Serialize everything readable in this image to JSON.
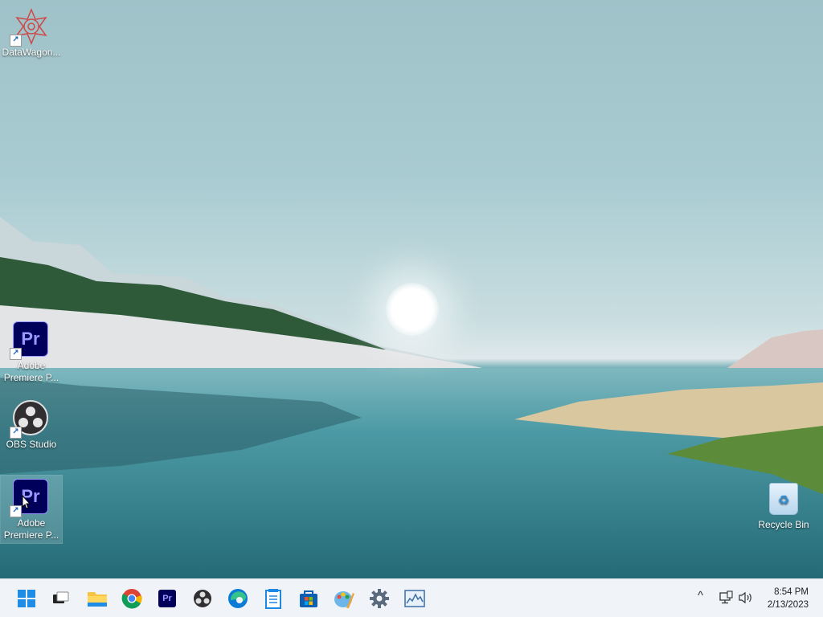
{
  "desktop": {
    "icons": [
      {
        "label": "DataWagon...",
        "icon": "datawagon-icon"
      },
      {
        "label": "Adobe Premiere P...",
        "icon": "premiere-pro-icon"
      },
      {
        "label": "OBS Studio",
        "icon": "obs-studio-icon"
      },
      {
        "label": "Adobe Premiere P...",
        "icon": "premiere-pro-icon"
      },
      {
        "label": "Recycle Bin",
        "icon": "recycle-bin-icon"
      }
    ],
    "premiere_glyph": "Pr"
  },
  "taskbar": {
    "apps": [
      {
        "name": "start",
        "icon": "windows-start-icon"
      },
      {
        "name": "task-view",
        "icon": "task-view-icon"
      },
      {
        "name": "file-explorer",
        "icon": "folder-icon"
      },
      {
        "name": "chrome",
        "icon": "chrome-icon"
      },
      {
        "name": "premiere-pro",
        "icon": "premiere-pro-icon"
      },
      {
        "name": "obs-studio",
        "icon": "obs-icon"
      },
      {
        "name": "edge",
        "icon": "edge-icon"
      },
      {
        "name": "notepad",
        "icon": "notepad-icon"
      },
      {
        "name": "microsoft-store",
        "icon": "store-icon"
      },
      {
        "name": "paint",
        "icon": "paint-icon"
      },
      {
        "name": "settings",
        "icon": "gear-icon"
      },
      {
        "name": "resource-monitor",
        "icon": "monitor-chart-icon"
      }
    ],
    "tray": {
      "chevron": "^",
      "network_icon": "network-icon",
      "volume_icon": "volume-icon"
    },
    "clock": {
      "time": "8:54 PM",
      "date": "2/13/2023"
    }
  },
  "colors": {
    "taskbar_bg": "#f0f3f8",
    "premiere_bg": "#00005b",
    "premiere_fg": "#9999ff"
  }
}
